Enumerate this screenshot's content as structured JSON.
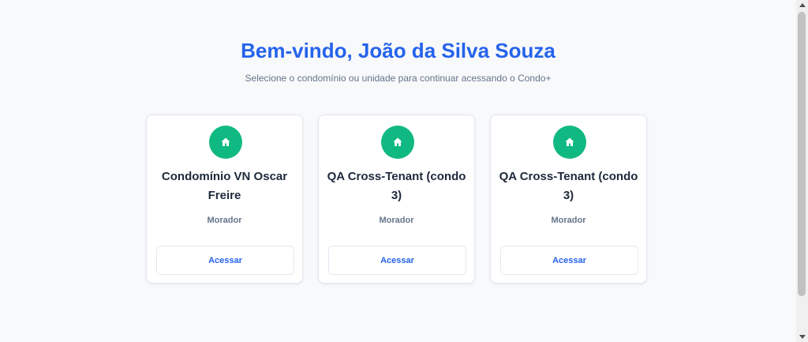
{
  "header": {
    "title": "Bem-vindo, João da Silva Souza",
    "subtitle": "Selecione o condomínio ou unidade para continuar acessando o Condo+"
  },
  "cards": [
    {
      "name": "Condomínio VN Oscar Freire",
      "role": "Morador",
      "button_label": "Acessar",
      "icon": "home-icon"
    },
    {
      "name": "QA Cross-Tenant (condo 3)",
      "role": "Morador",
      "button_label": "Acessar",
      "icon": "home-icon"
    },
    {
      "name": "QA Cross-Tenant (condo 3)",
      "role": "Morador",
      "button_label": "Acessar",
      "icon": "home-icon"
    }
  ],
  "colors": {
    "accent": "#2563eb",
    "icon_bg": "#10b981",
    "background": "#f8f9fb"
  }
}
